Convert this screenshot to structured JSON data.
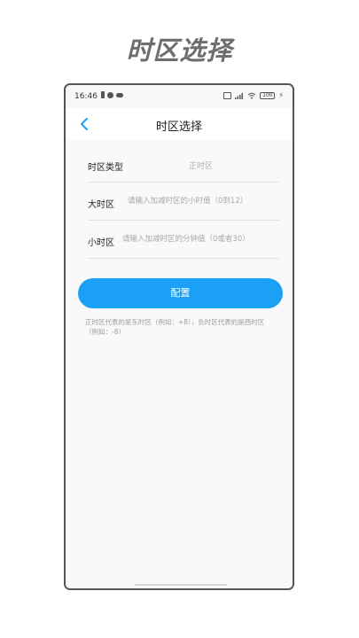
{
  "promo": {
    "title": "时区选择"
  },
  "status_bar": {
    "time": "16:46",
    "battery": "100"
  },
  "nav": {
    "title": "时区选择",
    "back_icon": "chevron-left-icon"
  },
  "form": {
    "type_row": {
      "label": "时区类型",
      "value": "正时区"
    },
    "hour_row": {
      "label": "大时区",
      "value": "",
      "placeholder": "请输入加减时区的小时值（0到12）"
    },
    "minute_row": {
      "label": "小时区",
      "value": "",
      "placeholder": "请输入加减时区的分钟值（0或者30）"
    }
  },
  "config_button": {
    "label": "配置"
  },
  "hint": "正时区代表的是东时区（例如：+8），负时区代表的是西时区（例如：-8）",
  "colors": {
    "accent": "#1aa0f5",
    "promo_title": "#6e6e6e",
    "background": "#f9f9f9"
  }
}
